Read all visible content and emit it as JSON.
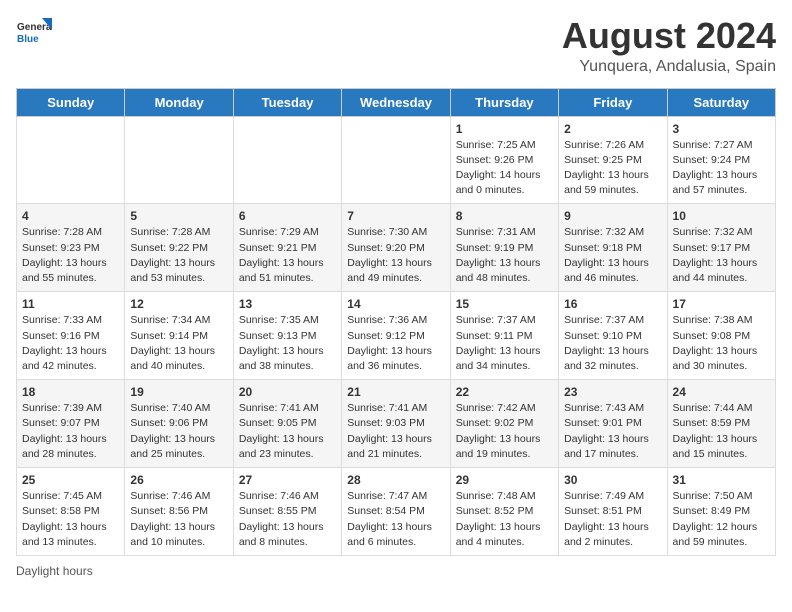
{
  "header": {
    "logo_general": "General",
    "logo_blue": "Blue",
    "month_year": "August 2024",
    "location": "Yunquera, Andalusia, Spain"
  },
  "footer": {
    "daylight_label": "Daylight hours"
  },
  "days_of_week": [
    "Sunday",
    "Monday",
    "Tuesday",
    "Wednesday",
    "Thursday",
    "Friday",
    "Saturday"
  ],
  "weeks": [
    [
      {
        "num": "",
        "info": ""
      },
      {
        "num": "",
        "info": ""
      },
      {
        "num": "",
        "info": ""
      },
      {
        "num": "",
        "info": ""
      },
      {
        "num": "1",
        "info": "Sunrise: 7:25 AM\nSunset: 9:26 PM\nDaylight: 14 hours\nand 0 minutes."
      },
      {
        "num": "2",
        "info": "Sunrise: 7:26 AM\nSunset: 9:25 PM\nDaylight: 13 hours\nand 59 minutes."
      },
      {
        "num": "3",
        "info": "Sunrise: 7:27 AM\nSunset: 9:24 PM\nDaylight: 13 hours\nand 57 minutes."
      }
    ],
    [
      {
        "num": "4",
        "info": "Sunrise: 7:28 AM\nSunset: 9:23 PM\nDaylight: 13 hours\nand 55 minutes."
      },
      {
        "num": "5",
        "info": "Sunrise: 7:28 AM\nSunset: 9:22 PM\nDaylight: 13 hours\nand 53 minutes."
      },
      {
        "num": "6",
        "info": "Sunrise: 7:29 AM\nSunset: 9:21 PM\nDaylight: 13 hours\nand 51 minutes."
      },
      {
        "num": "7",
        "info": "Sunrise: 7:30 AM\nSunset: 9:20 PM\nDaylight: 13 hours\nand 49 minutes."
      },
      {
        "num": "8",
        "info": "Sunrise: 7:31 AM\nSunset: 9:19 PM\nDaylight: 13 hours\nand 48 minutes."
      },
      {
        "num": "9",
        "info": "Sunrise: 7:32 AM\nSunset: 9:18 PM\nDaylight: 13 hours\nand 46 minutes."
      },
      {
        "num": "10",
        "info": "Sunrise: 7:32 AM\nSunset: 9:17 PM\nDaylight: 13 hours\nand 44 minutes."
      }
    ],
    [
      {
        "num": "11",
        "info": "Sunrise: 7:33 AM\nSunset: 9:16 PM\nDaylight: 13 hours\nand 42 minutes."
      },
      {
        "num": "12",
        "info": "Sunrise: 7:34 AM\nSunset: 9:14 PM\nDaylight: 13 hours\nand 40 minutes."
      },
      {
        "num": "13",
        "info": "Sunrise: 7:35 AM\nSunset: 9:13 PM\nDaylight: 13 hours\nand 38 minutes."
      },
      {
        "num": "14",
        "info": "Sunrise: 7:36 AM\nSunset: 9:12 PM\nDaylight: 13 hours\nand 36 minutes."
      },
      {
        "num": "15",
        "info": "Sunrise: 7:37 AM\nSunset: 9:11 PM\nDaylight: 13 hours\nand 34 minutes."
      },
      {
        "num": "16",
        "info": "Sunrise: 7:37 AM\nSunset: 9:10 PM\nDaylight: 13 hours\nand 32 minutes."
      },
      {
        "num": "17",
        "info": "Sunrise: 7:38 AM\nSunset: 9:08 PM\nDaylight: 13 hours\nand 30 minutes."
      }
    ],
    [
      {
        "num": "18",
        "info": "Sunrise: 7:39 AM\nSunset: 9:07 PM\nDaylight: 13 hours\nand 28 minutes."
      },
      {
        "num": "19",
        "info": "Sunrise: 7:40 AM\nSunset: 9:06 PM\nDaylight: 13 hours\nand 25 minutes."
      },
      {
        "num": "20",
        "info": "Sunrise: 7:41 AM\nSunset: 9:05 PM\nDaylight: 13 hours\nand 23 minutes."
      },
      {
        "num": "21",
        "info": "Sunrise: 7:41 AM\nSunset: 9:03 PM\nDaylight: 13 hours\nand 21 minutes."
      },
      {
        "num": "22",
        "info": "Sunrise: 7:42 AM\nSunset: 9:02 PM\nDaylight: 13 hours\nand 19 minutes."
      },
      {
        "num": "23",
        "info": "Sunrise: 7:43 AM\nSunset: 9:01 PM\nDaylight: 13 hours\nand 17 minutes."
      },
      {
        "num": "24",
        "info": "Sunrise: 7:44 AM\nSunset: 8:59 PM\nDaylight: 13 hours\nand 15 minutes."
      }
    ],
    [
      {
        "num": "25",
        "info": "Sunrise: 7:45 AM\nSunset: 8:58 PM\nDaylight: 13 hours\nand 13 minutes."
      },
      {
        "num": "26",
        "info": "Sunrise: 7:46 AM\nSunset: 8:56 PM\nDaylight: 13 hours\nand 10 minutes."
      },
      {
        "num": "27",
        "info": "Sunrise: 7:46 AM\nSunset: 8:55 PM\nDaylight: 13 hours\nand 8 minutes."
      },
      {
        "num": "28",
        "info": "Sunrise: 7:47 AM\nSunset: 8:54 PM\nDaylight: 13 hours\nand 6 minutes."
      },
      {
        "num": "29",
        "info": "Sunrise: 7:48 AM\nSunset: 8:52 PM\nDaylight: 13 hours\nand 4 minutes."
      },
      {
        "num": "30",
        "info": "Sunrise: 7:49 AM\nSunset: 8:51 PM\nDaylight: 13 hours\nand 2 minutes."
      },
      {
        "num": "31",
        "info": "Sunrise: 7:50 AM\nSunset: 8:49 PM\nDaylight: 12 hours\nand 59 minutes."
      }
    ]
  ]
}
